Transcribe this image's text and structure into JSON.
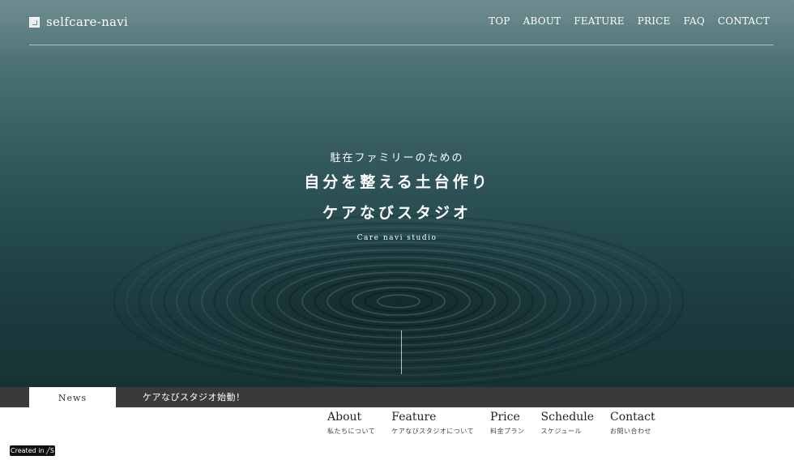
{
  "header": {
    "logo_text": "selfcare-navi",
    "nav": [
      "TOP",
      "ABOUT",
      "FEATURE",
      "PRICE",
      "FAQ",
      "CONTACT"
    ]
  },
  "hero": {
    "sub": "駐在ファミリーのための",
    "line1": "自分を整える土台作り",
    "line2": "ケアなびスタジオ",
    "en": "Care navi studio"
  },
  "news": {
    "tab_label": "News",
    "text": "ケアなびスタジオ始動！"
  },
  "footer_nav": [
    {
      "title": "About",
      "sub": "私たちについて"
    },
    {
      "title": "Feature",
      "sub": "ケアなびスタジオについて"
    },
    {
      "title": "Price",
      "sub": "料金プラン"
    },
    {
      "title": "Schedule",
      "sub": "スケジュール"
    },
    {
      "title": "Contact",
      "sub": "お問い合わせ"
    }
  ],
  "badge": {
    "label": "Created in ╱S"
  },
  "colors": {
    "hero_top": "#6f8d90",
    "hero_bottom": "#173235",
    "news_bar": "#3a3a3a",
    "text_dark": "#222222"
  },
  "icons": {
    "logo": "square-logo-icon"
  }
}
